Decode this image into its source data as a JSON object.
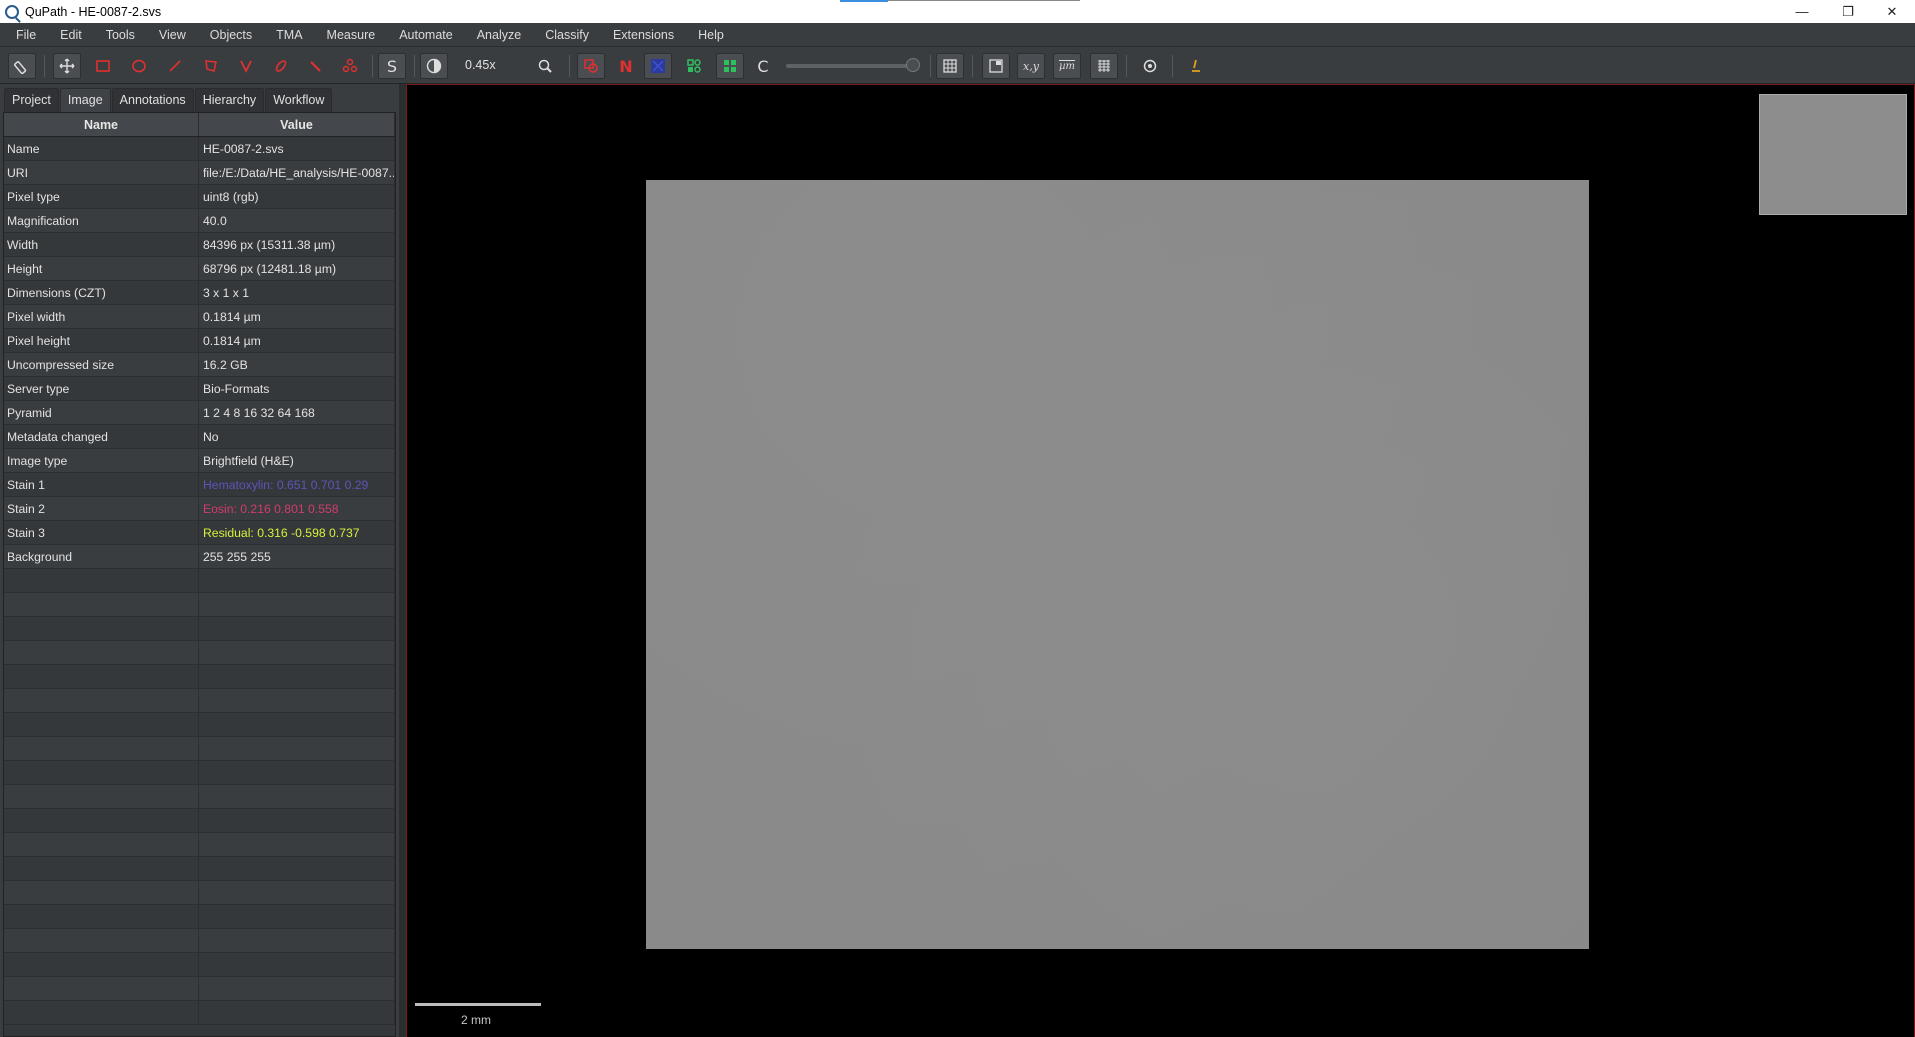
{
  "window": {
    "title": "QuPath - HE-0087-2.svs",
    "minimize": "—",
    "restore": "❐",
    "close": "✕"
  },
  "menu": [
    "File",
    "Edit",
    "Tools",
    "View",
    "Objects",
    "TMA",
    "Measure",
    "Automate",
    "Analyze",
    "Classify",
    "Extensions",
    "Help"
  ],
  "toolbar": {
    "zoom": "0.45x",
    "colors": {
      "red": "#e03030",
      "green": "#2fbf5f",
      "blue": "#3040d0",
      "orange": "#e0a020"
    }
  },
  "tabs": [
    "Project",
    "Image",
    "Annotations",
    "Hierarchy",
    "Workflow"
  ],
  "table": {
    "headers": {
      "name": "Name",
      "value": "Value"
    },
    "rows": [
      {
        "name": "Name",
        "value": "HE-0087-2.svs"
      },
      {
        "name": "URI",
        "value": "file:/E:/Data/HE_analysis/HE-0087..."
      },
      {
        "name": "Pixel type",
        "value": "uint8 (rgb)"
      },
      {
        "name": "Magnification",
        "value": "40.0"
      },
      {
        "name": "Width",
        "value": "84396 px (15311.38 µm)"
      },
      {
        "name": "Height",
        "value": "68796 px (12481.18 µm)"
      },
      {
        "name": "Dimensions (CZT)",
        "value": "3 x 1 x 1"
      },
      {
        "name": "Pixel width",
        "value": "0.1814 µm"
      },
      {
        "name": "Pixel height",
        "value": "0.1814 µm"
      },
      {
        "name": "Uncompressed size",
        "value": "16.2 GB"
      },
      {
        "name": "Server type",
        "value": "Bio-Formats"
      },
      {
        "name": "Pyramid",
        "value": "1 2 4 8 16 32 64 168"
      },
      {
        "name": "Metadata changed",
        "value": "No"
      },
      {
        "name": "Image type",
        "value": "Brightfield (H&E)"
      },
      {
        "name": "Stain 1",
        "value": "Hematoxylin: 0.651 0.701 0.29",
        "color": "#5b55b8"
      },
      {
        "name": "Stain 2",
        "value": "Eosin: 0.216 0.801 0.558",
        "color": "#d23c6e"
      },
      {
        "name": "Stain 3",
        "value": "Residual: 0.316 -0.598 0.737",
        "color": "#d6f03c"
      },
      {
        "name": "Background",
        "value": "255 255 255"
      }
    ]
  },
  "viewer": {
    "scalebar": "2 mm"
  }
}
